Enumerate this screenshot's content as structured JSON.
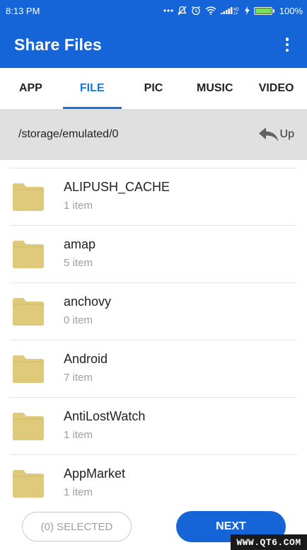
{
  "status_bar": {
    "time": "8:13 PM",
    "battery": "100%",
    "battery_level": 1.0,
    "network": "4G",
    "icons": [
      "more-dots-icon",
      "mute-icon",
      "alarm-icon",
      "wifi-icon",
      "signal-icon",
      "charging-icon",
      "battery-icon"
    ]
  },
  "app_bar": {
    "title": "Share Files",
    "menu_icon": "more-vert-icon"
  },
  "tabs": [
    {
      "label": "APP",
      "active": false
    },
    {
      "label": "FILE",
      "active": true
    },
    {
      "label": "PIC",
      "active": false
    },
    {
      "label": "MUSIC",
      "active": false
    },
    {
      "label": "VIDEO",
      "active": false
    }
  ],
  "path_bar": {
    "path": "/storage/emulated/0",
    "up_label": "Up",
    "up_icon": "reply-arrow-icon"
  },
  "files": [
    {
      "name": "ALIPUSH_CACHE",
      "count": "1 item",
      "icon": "folder-icon"
    },
    {
      "name": "amap",
      "count": "5 item",
      "icon": "folder-icon"
    },
    {
      "name": "anchovy",
      "count": "0 item",
      "icon": "folder-icon"
    },
    {
      "name": "Android",
      "count": "7 item",
      "icon": "folder-icon"
    },
    {
      "name": "AntiLostWatch",
      "count": "1 item",
      "icon": "folder-icon"
    },
    {
      "name": "AppMarket",
      "count": "1 item",
      "icon": "folder-icon"
    }
  ],
  "bottom_bar": {
    "selected_label": "(0) SELECTED",
    "next_label": "NEXT"
  },
  "watermark": "WWW.QT6.COM",
  "colors": {
    "primary": "#1565d8",
    "tab_active": "#1976d2",
    "folder": "#dfc97a",
    "path_bar_bg": "#e0e0e0"
  }
}
